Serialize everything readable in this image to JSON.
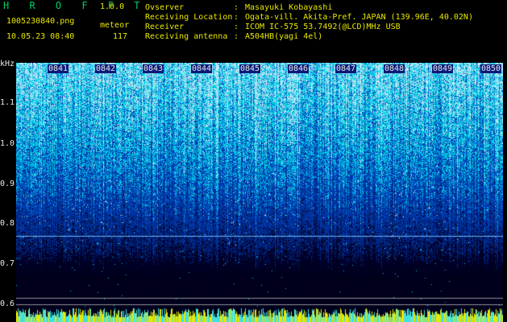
{
  "header": {
    "app_title": "H R O F F T",
    "version": "1.0.0",
    "filename": "1005230840.png",
    "mode": "meteor",
    "datetime": "10.05.23 08:40",
    "count": "117",
    "info": [
      {
        "key": "Ovserver",
        "value": "Masayuki Kobayashi"
      },
      {
        "key": "Receiving Location",
        "value": "Ogata-vill. Akita-Pref. JAPAN (139.96E, 40.02N)"
      },
      {
        "key": "Receiver",
        "value": "ICOM IC-575 53.7492(@LCD)MHz USB"
      },
      {
        "key": "Receiving antenna",
        "value": "A504HB(yagi 4el)"
      }
    ]
  },
  "spectrogram": {
    "unit_label": "kHz",
    "y_ticks": [
      "1.1",
      "1.0",
      "0.9",
      "0.8",
      "0.7",
      "0.6"
    ],
    "x_ticks": [
      "0841",
      "0842",
      "0843",
      "0844",
      "0845",
      "0846",
      "0847",
      "0848",
      "0849",
      "0850"
    ],
    "colors": {
      "background": "#000000",
      "text_yellow": "#e8e800",
      "text_green": "#00d060",
      "label_box": "#0a1a78"
    }
  }
}
